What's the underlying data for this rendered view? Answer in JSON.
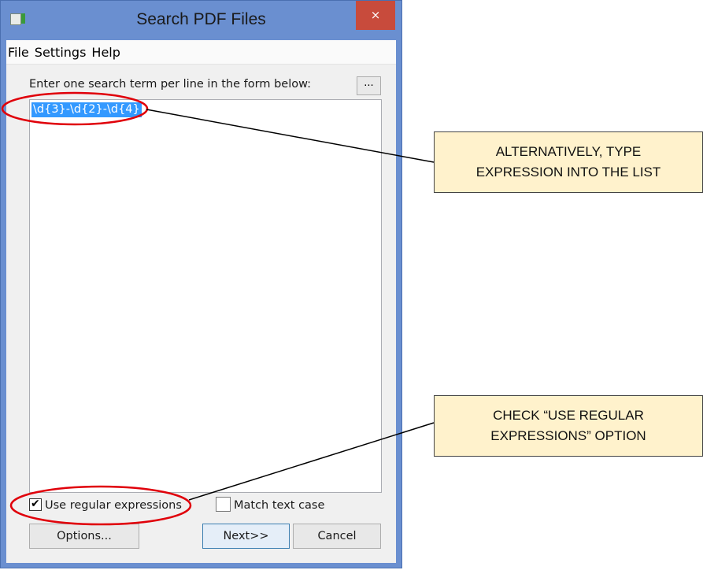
{
  "window": {
    "title": "Search PDF Files",
    "close_glyph": "×"
  },
  "menu": {
    "items": [
      "File",
      "Settings",
      "Help"
    ]
  },
  "form": {
    "instruction": "Enter one search term per line in the form below:",
    "browse_label": "...",
    "search_terms": [
      "\\d{3}-\\d{2}-\\d{4}"
    ]
  },
  "options": {
    "use_regex": {
      "label": "Use regular expressions",
      "checked": true
    },
    "match_case": {
      "label": "Match text case",
      "checked": false
    }
  },
  "buttons": {
    "options": "Options...",
    "next": "Next>>",
    "cancel": "Cancel"
  },
  "callouts": {
    "type_expression": [
      "ALTERNATIVELY, TYPE",
      "EXPRESSION INTO THE LIST"
    ],
    "check_regex": [
      "CHECK “USE REGULAR",
      "EXPRESSIONS” OPTION"
    ]
  },
  "colors": {
    "title_bar": "#6a8fd0",
    "close_button": "#c84b3c",
    "selection": "#3399ff",
    "callout_fill": "#fff2cc",
    "annotation_ellipse": "#e0000a"
  },
  "icons": [
    "app-icon",
    "close-icon",
    "checkmark-icon"
  ]
}
